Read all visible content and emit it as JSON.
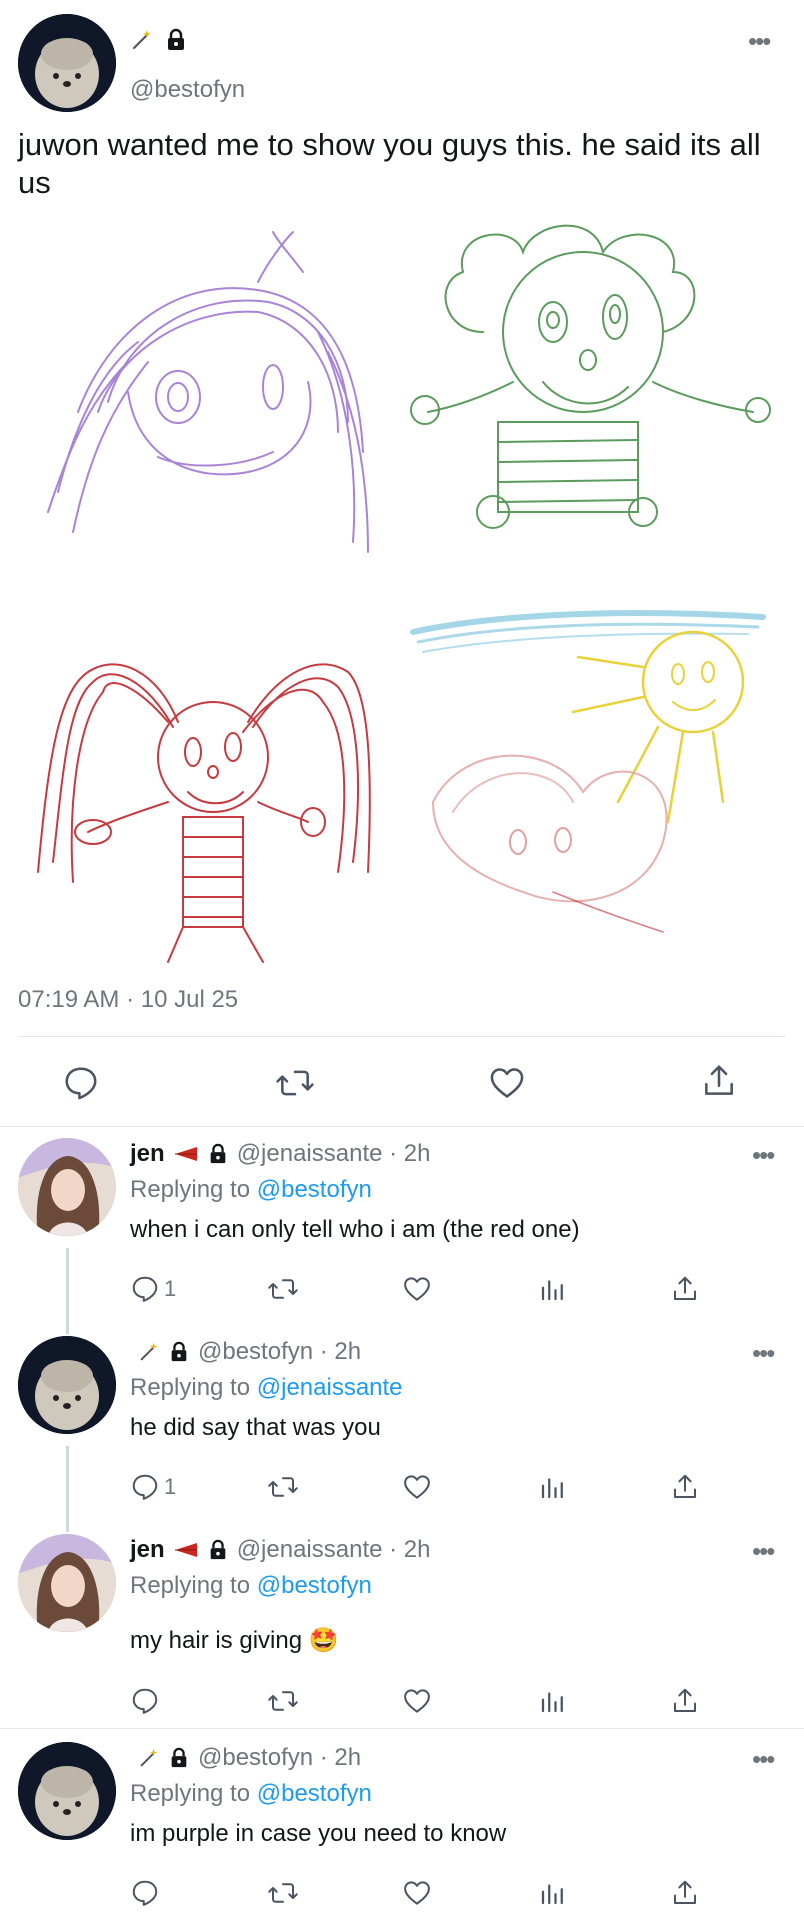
{
  "main_tweet": {
    "handle": "@bestofyn",
    "text": "juwon wanted me to show you guys this. he said its all us",
    "timestamp": "07:19 AM · 10 Jul 25",
    "more_icon": "more-icon",
    "actions": [
      "reply-icon",
      "retweet-icon",
      "like-icon",
      "share-icon"
    ]
  },
  "replies": [
    {
      "name": "jen",
      "handle_time": "@jenaissante · 2h",
      "replying_prefix": "Replying to",
      "replying_to": "@bestofyn",
      "text": "when i can only tell who i am (the red one)",
      "reply_count": "1"
    },
    {
      "name": "",
      "handle_time": "@bestofyn · 2h",
      "replying_prefix": "Replying to",
      "replying_to": "@jenaissante",
      "text": "he did say that was you",
      "reply_count": "1"
    },
    {
      "name": "jen",
      "handle_time": "@jenaissante · 2h",
      "replying_prefix": "Replying to",
      "replying_to": "@bestofyn",
      "text": "my hair is giving 🤩",
      "reply_count": ""
    },
    {
      "name": "",
      "handle_time": "@bestofyn · 2h",
      "replying_prefix": "Replying to",
      "replying_to": "@bestofyn",
      "text": "im purple in case you need to know",
      "reply_count": ""
    }
  ],
  "colors": {
    "link": "#1d9bf0",
    "muted": "#6e767d",
    "divider": "#e1e8ed",
    "purple_drawing": "#9b6fd0",
    "green_drawing": "#3f8a3f",
    "red_drawing": "#c0262c",
    "blue_drawing": "#5ab4d6",
    "yellow_drawing": "#e8d23a",
    "pink_drawing": "#e0a2a0"
  }
}
